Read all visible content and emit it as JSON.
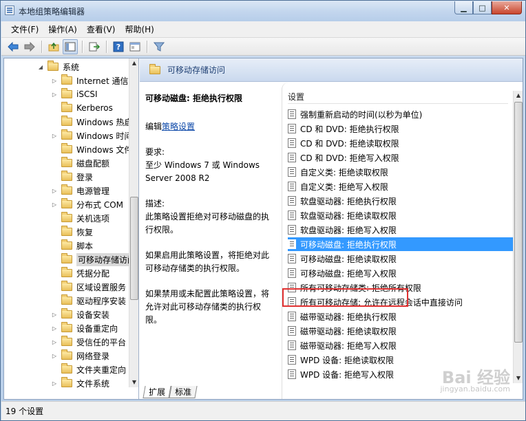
{
  "window": {
    "title": "本地组策略编辑器"
  },
  "caption": {
    "minimize": "▁",
    "maximize": "□",
    "close": "✕"
  },
  "menu": [
    "文件(F)",
    "操作(A)",
    "查看(V)",
    "帮助(H)"
  ],
  "toolbar": {
    "icons": [
      "back-arrow-icon",
      "forward-arrow-icon",
      "up-folder-icon",
      "show-tree-icon",
      "export-list-icon",
      "help-icon",
      "properties-icon",
      "filter-icon"
    ]
  },
  "tree": {
    "root_label": "系统",
    "items": [
      {
        "label": "Internet 通信",
        "expandable": true
      },
      {
        "label": "iSCSI",
        "expandable": true
      },
      {
        "label": "Kerberos",
        "expandable": false
      },
      {
        "label": "Windows 热启",
        "expandable": false
      },
      {
        "label": "Windows 时间",
        "expandable": true
      },
      {
        "label": "Windows 文件",
        "expandable": false
      },
      {
        "label": "磁盘配额",
        "expandable": false
      },
      {
        "label": "登录",
        "expandable": false
      },
      {
        "label": "电源管理",
        "expandable": true
      },
      {
        "label": "分布式 COM",
        "expandable": true
      },
      {
        "label": "关机选项",
        "expandable": false
      },
      {
        "label": "恢复",
        "expandable": false
      },
      {
        "label": "脚本",
        "expandable": false
      },
      {
        "label": "可移动存储访问",
        "expandable": false,
        "selected": true
      },
      {
        "label": "凭据分配",
        "expandable": false
      },
      {
        "label": "区域设置服务",
        "expandable": false
      },
      {
        "label": "驱动程序安装",
        "expandable": false
      },
      {
        "label": "设备安装",
        "expandable": true
      },
      {
        "label": "设备重定向",
        "expandable": true
      },
      {
        "label": "受信任的平台",
        "expandable": true
      },
      {
        "label": "网络登录",
        "expandable": true
      },
      {
        "label": "文件夹重定向",
        "expandable": false
      },
      {
        "label": "文件系统",
        "expandable": true
      }
    ]
  },
  "right": {
    "header_title": "可移动存储访问",
    "description": {
      "title": "可移动磁盘: 拒绝执行权限",
      "edit_prefix": "编辑",
      "edit_link": "策略设置",
      "requirements_label": "要求:",
      "requirements": "至少 Windows 7 或 Windows Server 2008 R2",
      "desc_label": "描述:",
      "desc_text": "此策略设置拒绝对可移动磁盘的执行权限。",
      "enabled_text": "如果启用此策略设置，将拒绝对此可移动存储类的执行权限。",
      "disabled_text": "如果禁用或未配置此策略设置，将允许对此可移动存储类的执行权限。"
    },
    "column_header": "设置",
    "settings": [
      "强制重新启动的时间(以秒为单位)",
      "CD 和 DVD: 拒绝执行权限",
      "CD 和 DVD: 拒绝读取权限",
      "CD 和 DVD: 拒绝写入权限",
      "自定义类: 拒绝读取权限",
      "自定义类: 拒绝写入权限",
      "软盘驱动器: 拒绝执行权限",
      "软盘驱动器: 拒绝读取权限",
      "软盘驱动器: 拒绝写入权限",
      "可移动磁盘: 拒绝执行权限",
      "可移动磁盘: 拒绝读取权限",
      "可移动磁盘: 拒绝写入权限",
      "所有可移动存储类: 拒绝所有权限",
      "所有可移动存储: 允许在远程会话中直接访问",
      "磁带驱动器: 拒绝执行权限",
      "磁带驱动器: 拒绝读取权限",
      "磁带驱动器: 拒绝写入权限",
      "WPD 设备: 拒绝读取权限",
      "WPD 设备: 拒绝写入权限"
    ],
    "selected_index": 9,
    "tabs": [
      "扩展",
      "标准"
    ]
  },
  "status": {
    "text": "19 个设置"
  },
  "watermark": {
    "logo": "Bai 经验",
    "sub": "jingyan.baidu.com"
  }
}
